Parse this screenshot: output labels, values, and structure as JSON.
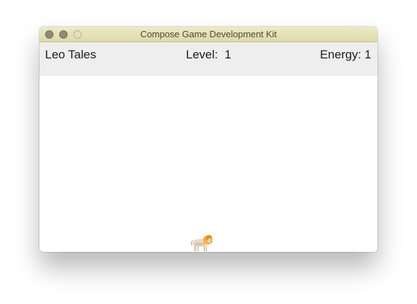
{
  "window": {
    "title": "Compose Game Development Kit"
  },
  "hud": {
    "game_title": "Leo Tales",
    "level_label": "Level:",
    "level_value": "1",
    "energy_label": "Energy:",
    "energy_value": "1"
  },
  "sprites": {
    "player": "lion-icon"
  },
  "colors": {
    "titlebar": "#e4e1b8",
    "hud_background": "#eeeeee",
    "playfield": "#ffffff",
    "lion_body": "#e8dcc8",
    "lion_mane": "#f2a23a"
  }
}
